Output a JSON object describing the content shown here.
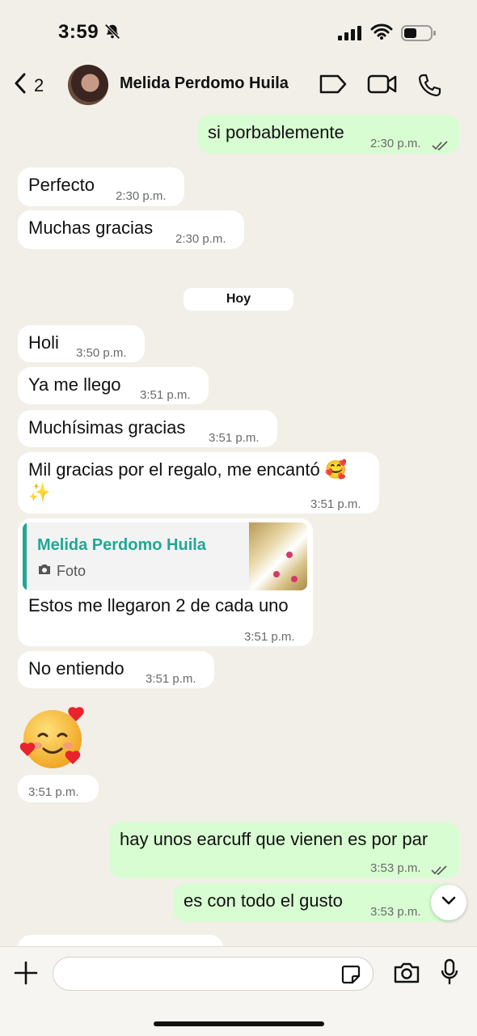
{
  "status_bar": {
    "time": "3:59"
  },
  "header": {
    "back_count": "2",
    "contact_name": "Melida Perdomo Huila"
  },
  "messages": [
    {
      "text": "si porbablemente",
      "time": "2:30 p.m."
    },
    {
      "text": "Perfecto",
      "time": "2:30 p.m."
    },
    {
      "text": "Muchas gracias",
      "time": "2:30 p.m."
    },
    {
      "text": "Holi",
      "time": "3:50 p.m."
    },
    {
      "text": "Ya me llego",
      "time": "3:51 p.m."
    },
    {
      "text": "Muchísimas gracias",
      "time": "3:51 p.m."
    },
    {
      "text": "Mil gracias por el regalo, me encantó 🥰",
      "text2": "✨",
      "time": "3:51 p.m."
    },
    {
      "text": "Estos me llegaron 2 de cada uno",
      "time": "3:51 p.m.",
      "quote_name": "Melida Perdomo Huila",
      "quote_type": "Foto"
    },
    {
      "text": "No entiendo",
      "time": "3:51 p.m."
    },
    {
      "text": "🥰",
      "time": "3:51 p.m."
    },
    {
      "text": "hay unos earcuff que vienen es por par",
      "time": "3:53 p.m."
    },
    {
      "text": "es con todo el gusto",
      "time": "3:53 p.m."
    }
  ],
  "day_separator": "Hoy",
  "input": {
    "placeholder": ""
  },
  "colors": {
    "outgoing": "#D8FDD2",
    "incoming": "#FFFFFF",
    "background": "#F2EFE8",
    "accent": "#1FA894"
  },
  "icons": [
    "bell-slash-icon",
    "signal-icon",
    "wifi-icon",
    "battery-icon",
    "back-chevron-icon",
    "label-icon",
    "video-call-icon",
    "phone-icon",
    "double-check-icon",
    "camera-icon",
    "chevron-down-icon",
    "plus-icon",
    "sticker-icon",
    "microphone-icon"
  ]
}
